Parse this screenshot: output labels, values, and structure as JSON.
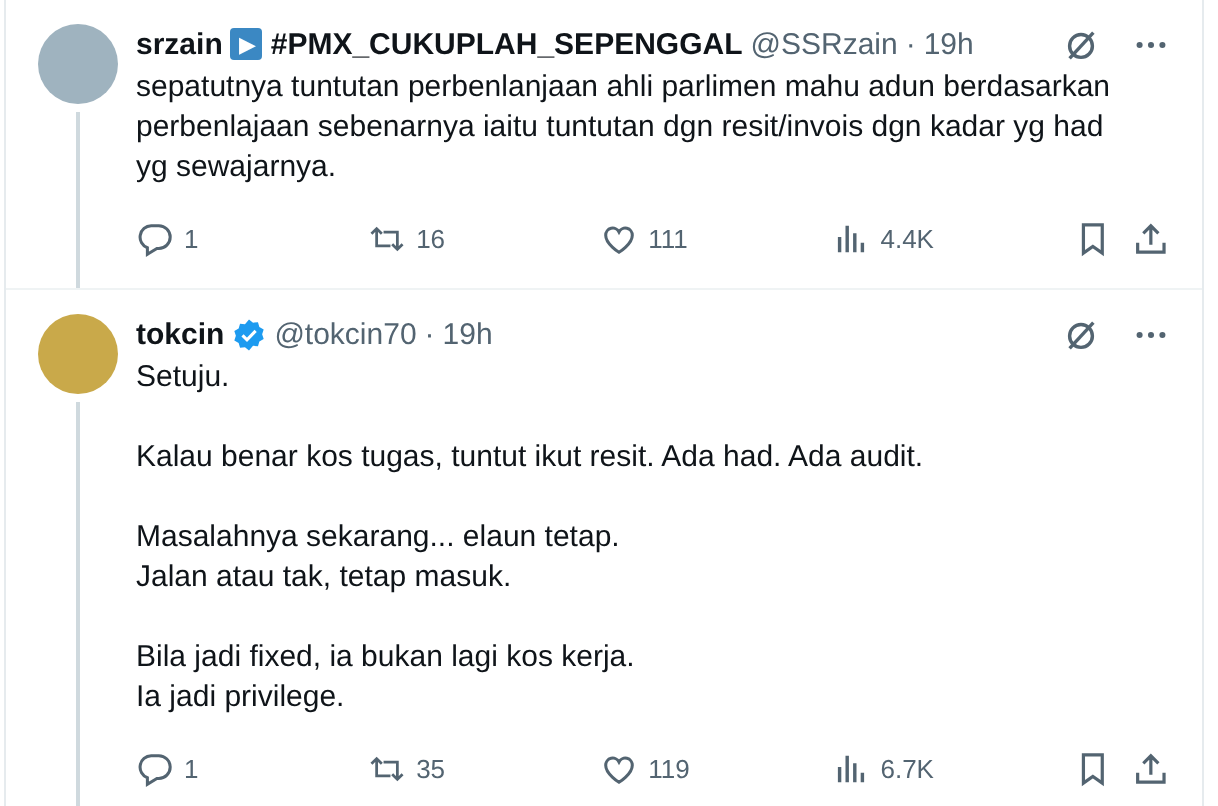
{
  "tweets": [
    {
      "name": "srzain",
      "name_emoji": "▶",
      "name_suffix": "#PMX_CUKUPLAH_SEPENGGAL",
      "handle": "@SSRzain",
      "separator": "·",
      "time": "19h",
      "thread_line": true,
      "paragraphs": [
        [
          "sepatutnya tuntutan perbenlanjaan ahli parlimen mahu adun berdasarkan perbenlajaan sebenarnya iaitu tuntutan dgn resit/invois dgn kadar yg had yg sewajarnya."
        ]
      ],
      "replies": "1",
      "reposts": "16",
      "likes": "111",
      "views": "4.4K"
    },
    {
      "name": "tokcin",
      "verified": true,
      "handle": "@tokcin70",
      "separator": "·",
      "time": "19h",
      "thread_line": true,
      "paragraphs": [
        [
          "Setuju."
        ],
        [
          "Kalau benar kos tugas, tuntut ikut resit. Ada had. Ada audit."
        ],
        [
          "Masalahnya sekarang... elaun tetap.",
          "Jalan atau tak, tetap masuk."
        ],
        [
          "Bila jadi fixed, ia bukan lagi kos kerja.",
          "Ia jadi privilege."
        ]
      ],
      "replies": "1",
      "reposts": "35",
      "likes": "119",
      "views": "6.7K"
    }
  ]
}
